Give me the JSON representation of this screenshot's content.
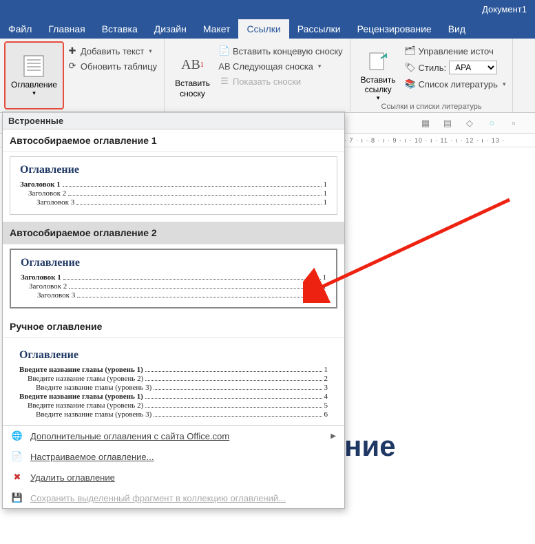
{
  "titlebar": {
    "document": "Документ1"
  },
  "tabs": {
    "file": "Файл",
    "home": "Главная",
    "insert": "Вставка",
    "design": "Дизайн",
    "layout": "Макет",
    "references": "Ссылки",
    "mailings": "Рассылки",
    "review": "Рецензирование",
    "view": "Вид"
  },
  "ribbon": {
    "toc_btn": "Оглавление",
    "add_text": "Добавить текст",
    "update_table": "Обновить таблицу",
    "insert_footnote": "Вставить\nсноску",
    "ab_badge": "AB",
    "insert_endnote": "Вставить концевую сноску",
    "next_footnote": "Следующая сноска",
    "show_footnotes": "Показать сноски",
    "insert_link": "Вставить\nссылку",
    "manage_sources": "Управление источ",
    "style_label": "Стиль:",
    "style_value": "APA",
    "bibliography": "Список литературь",
    "group_label": "Ссылки и списки литературь"
  },
  "ruler": "· 7 · ı · 8 · ı · 9 · ı · 10 · ı · 11 · ı · 12 · ı · 13 ·",
  "gallery": {
    "section_builtin": "Встроенные",
    "auto1_title": "Автособираемое оглавление 1",
    "auto2_title": "Автособираемое оглавление 2",
    "manual_title": "Ручное оглавление",
    "toc_heading": "Оглавление",
    "auto_lines": [
      {
        "level": 1,
        "text": "Заголовок 1",
        "page": "1"
      },
      {
        "level": 2,
        "text": "Заголовок 2",
        "page": "1"
      },
      {
        "level": 3,
        "text": "Заголовок 3",
        "page": "1"
      }
    ],
    "manual_lines": [
      {
        "level": 1,
        "text": "Введите название главы (уровень 1)",
        "page": "1"
      },
      {
        "level": 2,
        "text": "Введите название главы (уровень 2)",
        "page": "2"
      },
      {
        "level": 3,
        "text": "Введите название главы (уровень 3)",
        "page": "3"
      },
      {
        "level": 1,
        "text": "Введите название главы (уровень 1)",
        "page": "4"
      },
      {
        "level": 2,
        "text": "Введите название главы (уровень 2)",
        "page": "5"
      },
      {
        "level": 3,
        "text": "Введите название главы (уровень 3)",
        "page": "6"
      }
    ],
    "menu": {
      "more_office": "Дополнительные оглавления с сайта Office.com",
      "custom": "Настраиваемое оглавление...",
      "remove": "Удалить оглавление",
      "save_selection": "Сохранить выделенный фрагмент в коллекцию оглавлений..."
    }
  },
  "doc": {
    "heading_fragment": "ние"
  }
}
